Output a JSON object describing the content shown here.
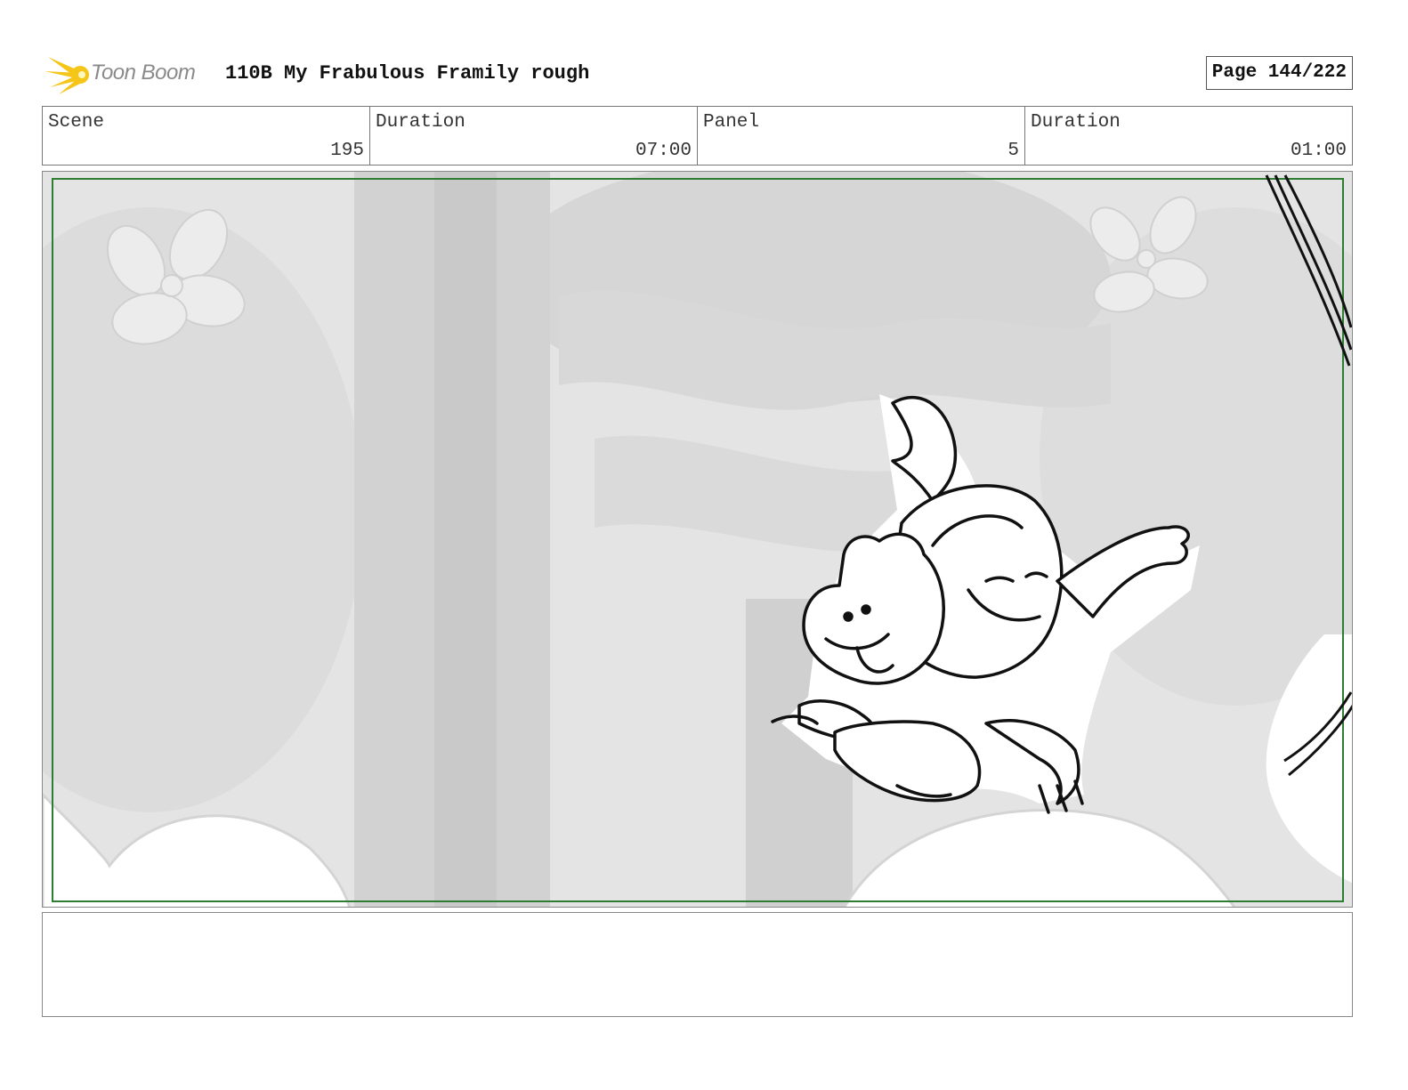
{
  "header": {
    "logo_text": "Toon Boom",
    "title": "110B My Frabulous Framily rough",
    "page": "Page 144/222"
  },
  "info": [
    {
      "label": "Scene",
      "value": "195"
    },
    {
      "label": "Duration",
      "value": "07:00"
    },
    {
      "label": "Panel",
      "value": "5"
    },
    {
      "label": "Duration",
      "value": "01:00"
    }
  ],
  "colors": {
    "safe_frame": "#2e7d32",
    "logo_yellow": "#f5c518"
  },
  "notes": ""
}
